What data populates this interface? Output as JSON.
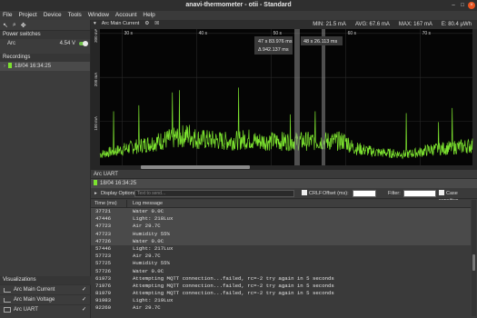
{
  "window": {
    "title": "anavi-thermometer - otii - Standard"
  },
  "menu": [
    "File",
    "Project",
    "Device",
    "Tools",
    "Window",
    "Account",
    "Help"
  ],
  "sidebar": {
    "power_header": "Power switches",
    "power": {
      "label": "Arc",
      "value": "4.54 V",
      "on": true
    },
    "recordings_header": "Recordings",
    "recording": "18/04 16:34:25",
    "visualizations_header": "Visualizations",
    "visualizations": [
      {
        "label": "Arc Main Current",
        "checked": "✓"
      },
      {
        "label": "Arc Main Voltage",
        "checked": "✓"
      },
      {
        "label": "Arc UART",
        "checked": "✓"
      }
    ]
  },
  "plot": {
    "title": "Arc Main Current",
    "stats": {
      "min": "MIN: 21.5 mA",
      "avg": "AVG: 67.6 mA",
      "max": "MAX: 167 mA",
      "energy": "E: 80.4 µWh"
    },
    "cursor1": {
      "time": "47 s 83.976 ms",
      "delta": "Δ 942.137 ms"
    },
    "cursor2": {
      "time": "48 s 26.113 ms"
    }
  },
  "chart_data": {
    "type": "line",
    "title": "Arc Main Current",
    "x_ticks": [
      "30 s",
      "40 s",
      "50 s",
      "60 s",
      "70 s"
    ],
    "y_ticks": [
      "300 mA",
      "200 mA",
      "100 mA"
    ],
    "xlim": [
      27,
      77
    ],
    "ylim": [
      0,
      310
    ],
    "series": [
      {
        "x": [
          27,
          31,
          35,
          39,
          40,
          44,
          47,
          48,
          49,
          53,
          57,
          60,
          61,
          64,
          68,
          70,
          71,
          74,
          77
        ],
        "y": [
          25,
          40,
          55,
          70,
          60,
          55,
          60,
          55,
          55,
          55,
          55,
          55,
          40,
          30,
          25,
          30,
          35,
          40,
          45
        ]
      }
    ],
    "grid": true,
    "color": "#7ce22f"
  },
  "uart": {
    "title": "Arc UART",
    "recording": "18/04 16:34:25",
    "display_options": "Display Options",
    "send_placeholder": "Text to send...",
    "crlf": "CRLF",
    "offset_label": "Offset (ms):",
    "filter_label": "Filter:",
    "case_sensitive": "Case sensitive",
    "col_time": "Time (ms)",
    "col_msg": "Log message",
    "rows": [
      {
        "t": "37721",
        "m": "Water 0.0C",
        "hl": true
      },
      {
        "t": "47446",
        "m": "Light: 218Lux",
        "hl": true
      },
      {
        "t": "47723",
        "m": "Air 29.7C",
        "hl": true
      },
      {
        "t": "47723",
        "m": "Humidity 55%",
        "hl": true
      },
      {
        "t": "47726",
        "m": "Water 0.0C",
        "hl": true
      },
      {
        "t": "57446",
        "m": "Light: 217Lux",
        "hl": false
      },
      {
        "t": "57723",
        "m": "Air 29.7C",
        "hl": false
      },
      {
        "t": "57725",
        "m": "Humidity 55%",
        "hl": false
      },
      {
        "t": "57726",
        "m": "Water 0.0C",
        "hl": false
      },
      {
        "t": "61973",
        "m": "Attempting MQTT connection...failed, rc=-2 try again in 5 seconds",
        "hl": false
      },
      {
        "t": "71976",
        "m": "Attempting MQTT connection...failed, rc=-2 try again in 5 seconds",
        "hl": false
      },
      {
        "t": "81979",
        "m": "Attempting MQTT connection...failed, rc=-2 try again in 5 seconds",
        "hl": false
      },
      {
        "t": "91983",
        "m": "Light: 219Lux",
        "hl": false
      },
      {
        "t": "92260",
        "m": "Air 29.7C",
        "hl": false
      }
    ]
  }
}
